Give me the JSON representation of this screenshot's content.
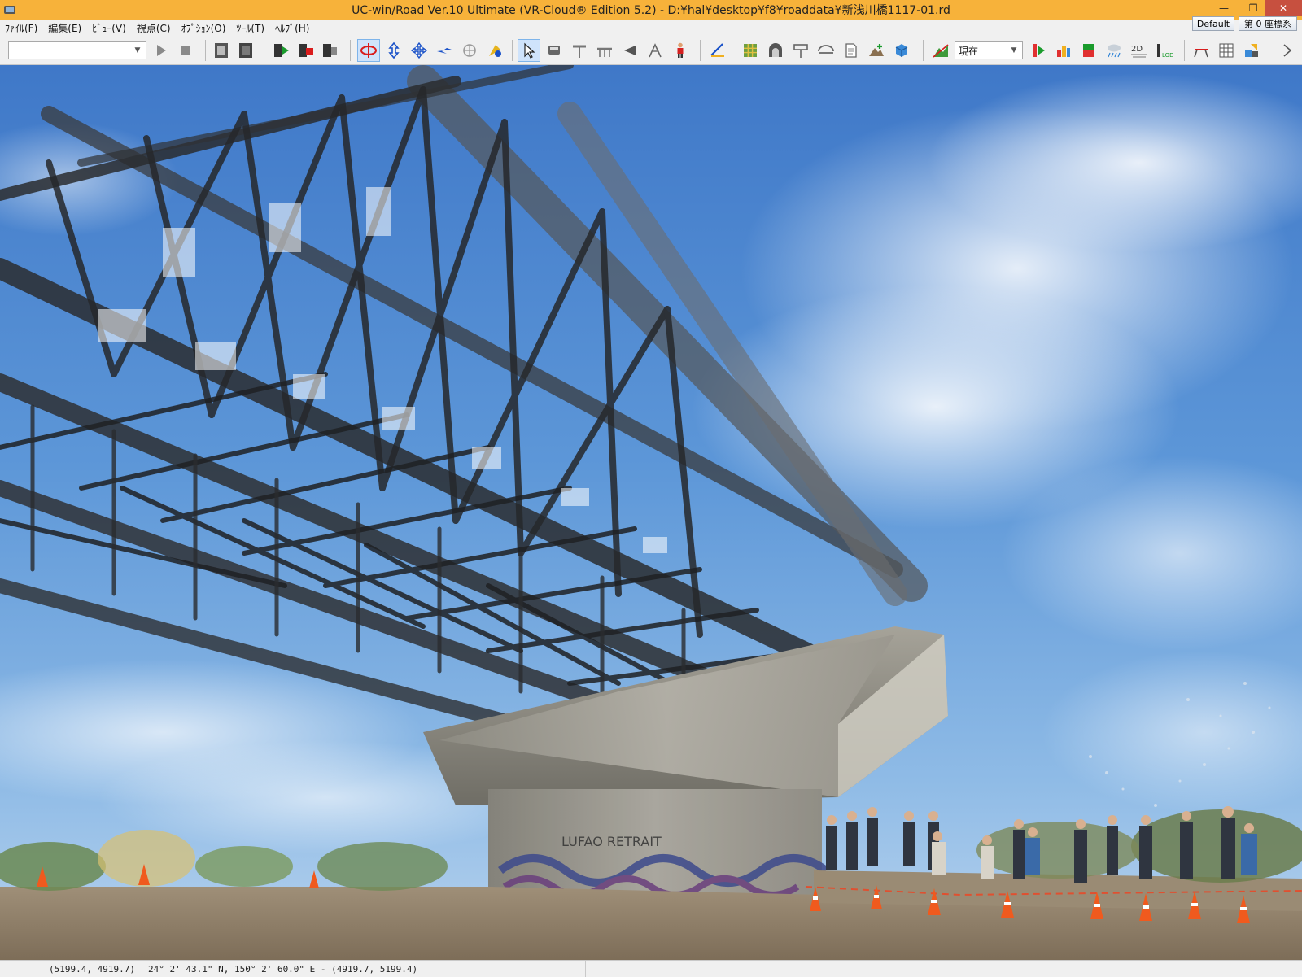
{
  "window": {
    "title": "UC-win/Road Ver.10 Ultimate (VR-Cloud® Edition 5.2) - D:¥hal¥desktop¥f8¥roaddata¥新浅川橋1117-01.rd",
    "minimize_glyph": "—",
    "maximize_glyph": "❐",
    "close_glyph": "✕"
  },
  "menu": {
    "items": [
      {
        "label": "ﾌｧｲﾙ(F)"
      },
      {
        "label": "編集(E)"
      },
      {
        "label": "ﾋﾞｭｰ(V)"
      },
      {
        "label": "視点(C)"
      },
      {
        "label": "ｵﾌﾟｼｮﾝ(O)"
      },
      {
        "label": "ﾂｰﾙ(T)"
      },
      {
        "label": "ﾍﾙﾌﾟ(H)"
      }
    ],
    "default_button": "Default",
    "coord_system_button": "第 0 座標系"
  },
  "toolbar": {
    "scenario_combo_value": "",
    "time_combo_value": "現在",
    "icons": [
      "play-icon",
      "stop-icon",
      "film-strip-icon",
      "film-strip-dark-icon",
      "script-play-icon",
      "script-record-icon",
      "script-edit-icon",
      "rotate-view-icon",
      "vertical-move-icon",
      "pan-move-icon",
      "fly-icon",
      "orbit-icon",
      "walk-icon",
      "select-pointer-icon",
      "vehicle-icon",
      "road-sign-icon",
      "guardrail-icon",
      "light-pole-icon",
      "measure-icon",
      "character-icon",
      "ruler-icon",
      "grid-map-icon",
      "tunnel-icon",
      "signboard-icon",
      "bridge-icon",
      "document-icon",
      "terrain-add-icon",
      "cube-model-icon",
      "terrain-edit-icon",
      "traffic-signal-icon",
      "building-icon",
      "flag-icon",
      "weather-icon",
      "2d-view-icon",
      "lod-icon",
      "section-view-icon",
      "spreadsheet-icon",
      "model-tools-icon",
      "more-icon"
    ]
  },
  "status": {
    "cursor_coords": "(5199.4, 4919.7)",
    "geo_coords": "24°  2' 43.1\" N, 150°  2' 60.0\" E  - (4919.7, 5199.4)",
    "extra": ""
  },
  "viewport": {
    "scene": "point-cloud-bridge",
    "graffiti_text": "LUFAO  RETRAIT"
  }
}
